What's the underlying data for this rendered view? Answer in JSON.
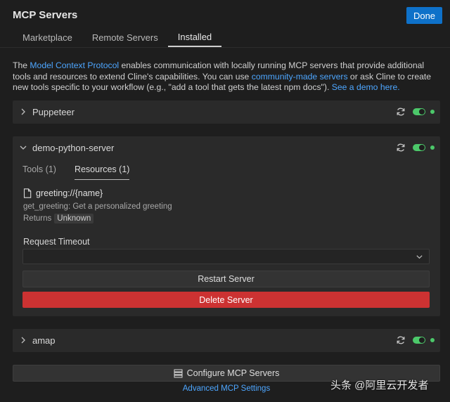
{
  "header": {
    "title": "MCP Servers",
    "done_label": "Done"
  },
  "tabs": [
    {
      "label": "Marketplace",
      "active": false
    },
    {
      "label": "Remote Servers",
      "active": false
    },
    {
      "label": "Installed",
      "active": true
    }
  ],
  "intro": {
    "t1": "The ",
    "link1": "Model Context Protocol",
    "t2": " enables communication with locally running MCP servers that provide additional tools and resources to extend Cline's capabilities. You can use ",
    "link2": "community-made servers",
    "t3": " or ask Cline to create new tools specific to your workflow (e.g., \"add a tool that gets the latest npm docs\"). ",
    "link3": "See a demo here."
  },
  "servers": [
    {
      "name": "Puppeteer",
      "expanded": false,
      "enabled": true,
      "status": "connected"
    },
    {
      "name": "demo-python-server",
      "expanded": true,
      "enabled": true,
      "status": "connected",
      "sub_tabs": [
        {
          "label": "Tools (1)",
          "active": false
        },
        {
          "label": "Resources (1)",
          "active": true
        }
      ],
      "resource": {
        "uri": "greeting://{name}",
        "description": "get_greeting: Get a personalized greeting",
        "returns_label": "Returns",
        "returns_value": "Unknown"
      },
      "timeout_label": "Request Timeout",
      "timeout_value": "",
      "restart_label": "Restart Server",
      "delete_label": "Delete Server"
    },
    {
      "name": "amap",
      "expanded": false,
      "enabled": true,
      "status": "connected"
    }
  ],
  "footer": {
    "configure_label": "Configure MCP Servers",
    "advanced_label": "Advanced MCP Settings"
  },
  "watermark": "头条 @阿里云开发者",
  "colors": {
    "accent": "#0e71c9",
    "link": "#4da6ff",
    "success": "#4cc86a",
    "danger": "#cc3232"
  }
}
